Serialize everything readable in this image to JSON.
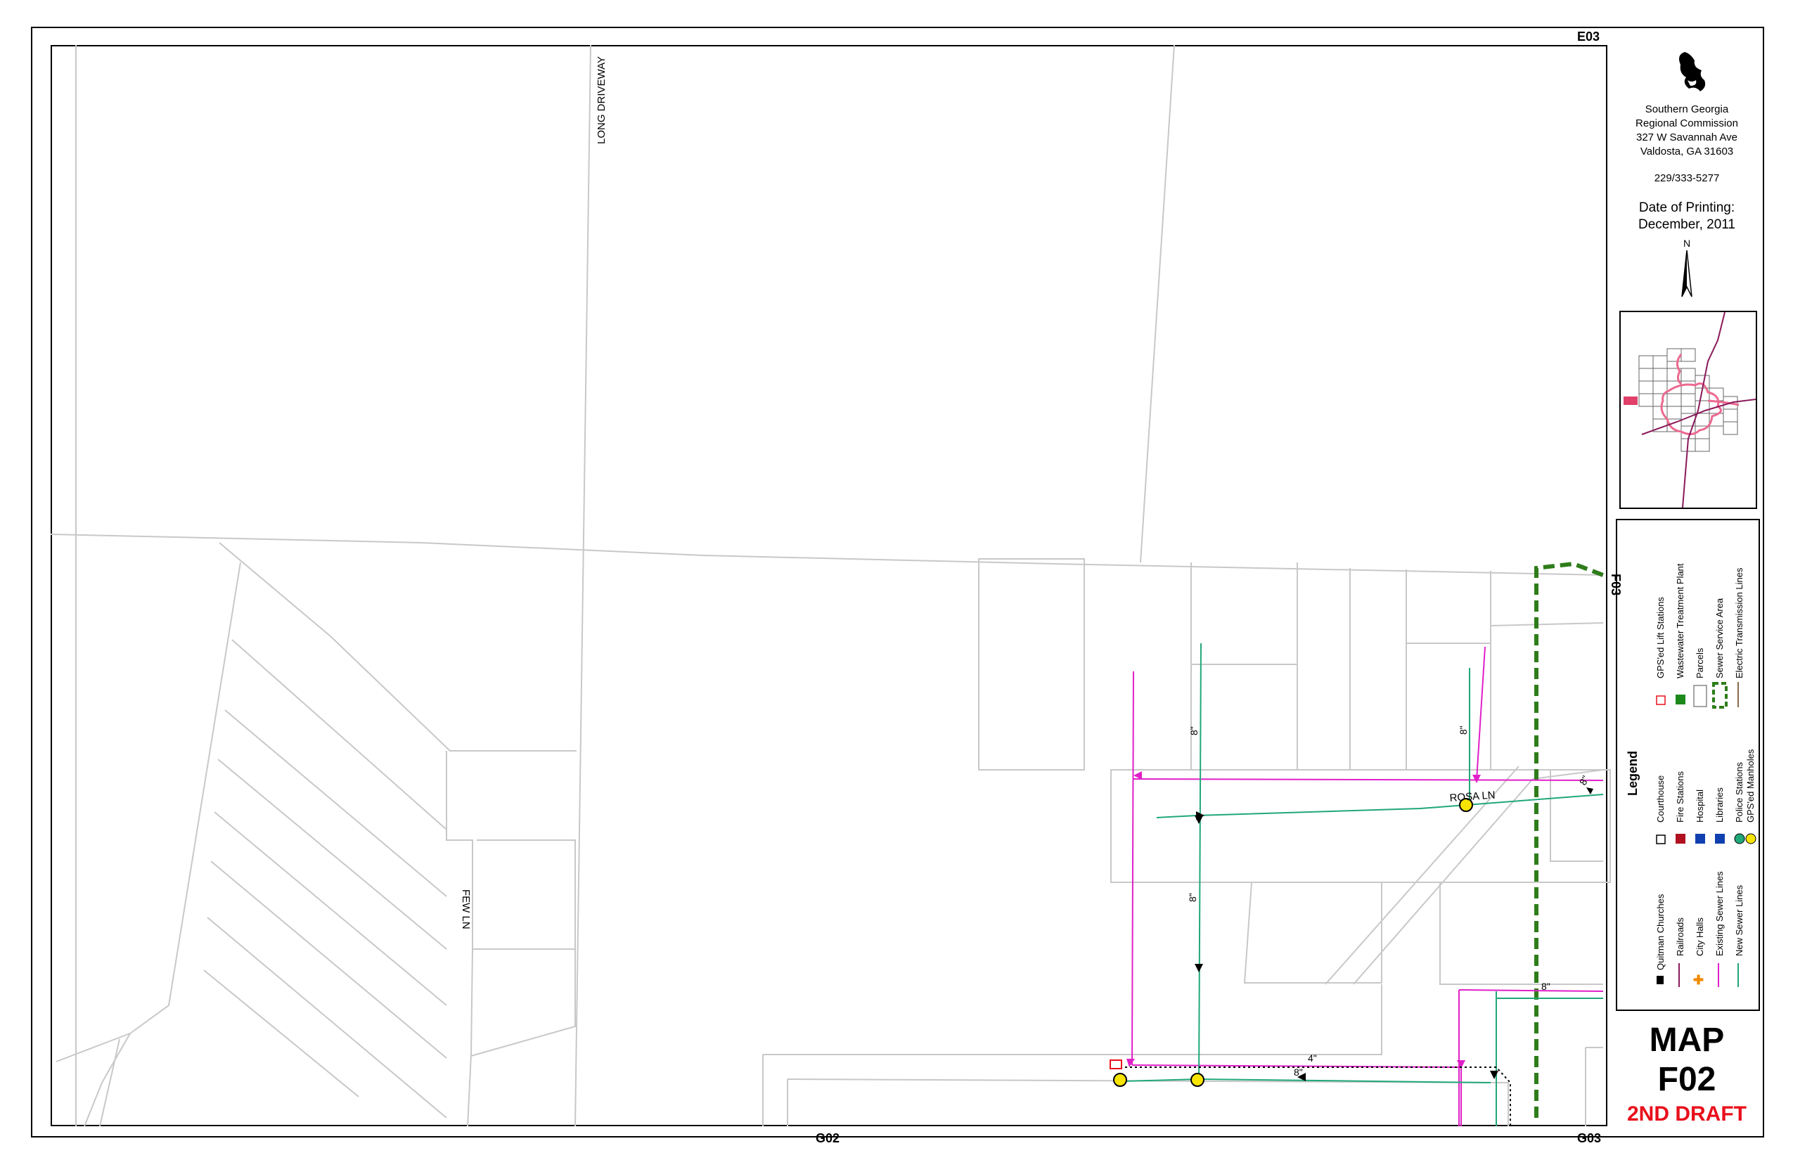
{
  "map": {
    "grid_labels": {
      "top_right": "E03",
      "right": "F03",
      "bottom": "G02",
      "bottom_right": "G03"
    },
    "street_labels": {
      "long_driveway": "LONG DRIVEWAY",
      "few_ln": "FEW LN",
      "rosa_ln": "ROSA LN"
    },
    "pipe_labels": [
      "8\"",
      "8\"",
      "8\"",
      "8\"",
      "4\"",
      "8\"",
      "8\""
    ],
    "colors": {
      "existing_sewer": "#e020c8",
      "new_sewer": "#20a878",
      "service_area": "#2e7d1a",
      "parcel": "#c8c8c8"
    }
  },
  "agency": {
    "name_line1": "Southern Georgia",
    "name_line2": "Regional Commission",
    "address_line1": "327 W Savannah Ave",
    "address_line2": "Valdosta, GA  31603",
    "phone": "229/333-5277",
    "date_label": "Date of Printing:",
    "date_value": "December, 2011",
    "north_label": "N"
  },
  "legend": {
    "title": "Legend",
    "items": [
      "Quitman Churches",
      "Railroads",
      "City Halls",
      "Existing Sewer Lines",
      "New Sewer Lines",
      "Courthouse",
      "Fire Stations",
      "Hospital",
      "Libraries",
      "Police Stations",
      "GPS'ed Manholes",
      "GPS'ed Lift Stations",
      "Wastewater Treatment Plant",
      "Parcels",
      "Sewer Service Area",
      "Electric Transmission Lines"
    ]
  },
  "title_block": {
    "map_word": "MAP",
    "map_id": "F02",
    "draft": "2ND DRAFT"
  }
}
